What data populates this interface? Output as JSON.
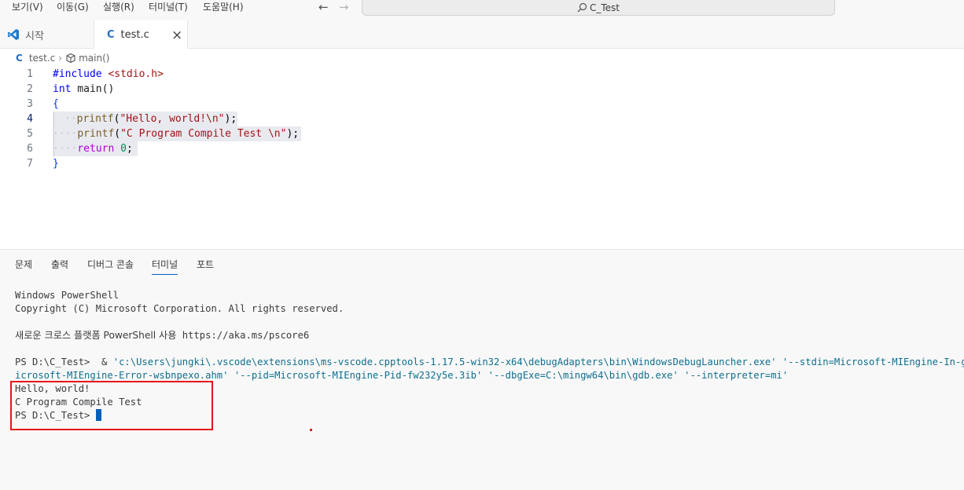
{
  "menu": {
    "view": "보기(V)",
    "go": "이동(G)",
    "run": "실행(R)",
    "terminal": "터미널(T)",
    "help": "도움말(H)"
  },
  "nav": {
    "back": "←",
    "forward": "→"
  },
  "search": {
    "text": "C_Test"
  },
  "tabs": {
    "welcome": "시작",
    "file": "test.c",
    "close": "×"
  },
  "breadcrumb": {
    "file": "test.c",
    "symbol": "main()"
  },
  "code": {
    "line_numbers": [
      "1",
      "2",
      "3",
      "4",
      "5",
      "6",
      "7"
    ],
    "l1_directive": "#include",
    "l1_header": "<stdio.h>",
    "l2_type": "int",
    "l2_name": " main()",
    "l3": "{",
    "l4_ws": "··",
    "l4_fn": "printf",
    "l4_open": "(",
    "l4_str": "\"Hello, world!\\n\"",
    "l4_close": ");",
    "l5_ws": "····",
    "l5_fn": "printf",
    "l5_open": "(",
    "l5_str": "\"C Program Compile Test \\n\"",
    "l5_close": ");",
    "l6_ws": "····",
    "l6_kw": "return",
    "l6_num": "0",
    "l6_end": ";",
    "l7": "}"
  },
  "panel_tabs": {
    "problems": "문제",
    "output": "출력",
    "debug_console": "디버그 콘솔",
    "terminal": "터미널",
    "ports": "포트"
  },
  "terminal": {
    "l1": "Windows PowerShell",
    "l2": "Copyright (C) Microsoft Corporation. All rights reserved.",
    "l3_kor": "새로운 크로스 플랫폼 PowerShell 사용",
    "l3_url": " https://aka.ms/pscore6",
    "l4_prompt": "PS D:\\C_Test>  & ",
    "l4_cmd": "'c:\\Users\\jungki\\.vscode\\extensions\\ms-vscode.cpptools-1.17.5-win32-x64\\debugAdapters\\bin\\WindowsDebugLauncher.exe' '--stdin=Microsoft-MIEngine-In-gtccwtds",
    "l5": "icrosoft-MIEngine-Error-wsbnpexo.ahm' '--pid=Microsoft-MIEngine-Pid-fw232y5e.3ib' '--dbgExe=C:\\mingw64\\bin\\gdb.exe' '--interpreter=mi'",
    "l6": "Hello, world!",
    "l7": "C Program Compile Test",
    "l8": "PS D:\\C_Test> "
  },
  "colors": {
    "accent": "#005fb8",
    "annotation_red": "#e8141b",
    "string": "#a31515",
    "keyword": "#0000ff"
  },
  "icons": {
    "vscode": "vscode-logo-icon",
    "c_file": "c-language-icon",
    "symbol": "method-cube-icon",
    "search": "search-icon",
    "close": "close-icon"
  }
}
